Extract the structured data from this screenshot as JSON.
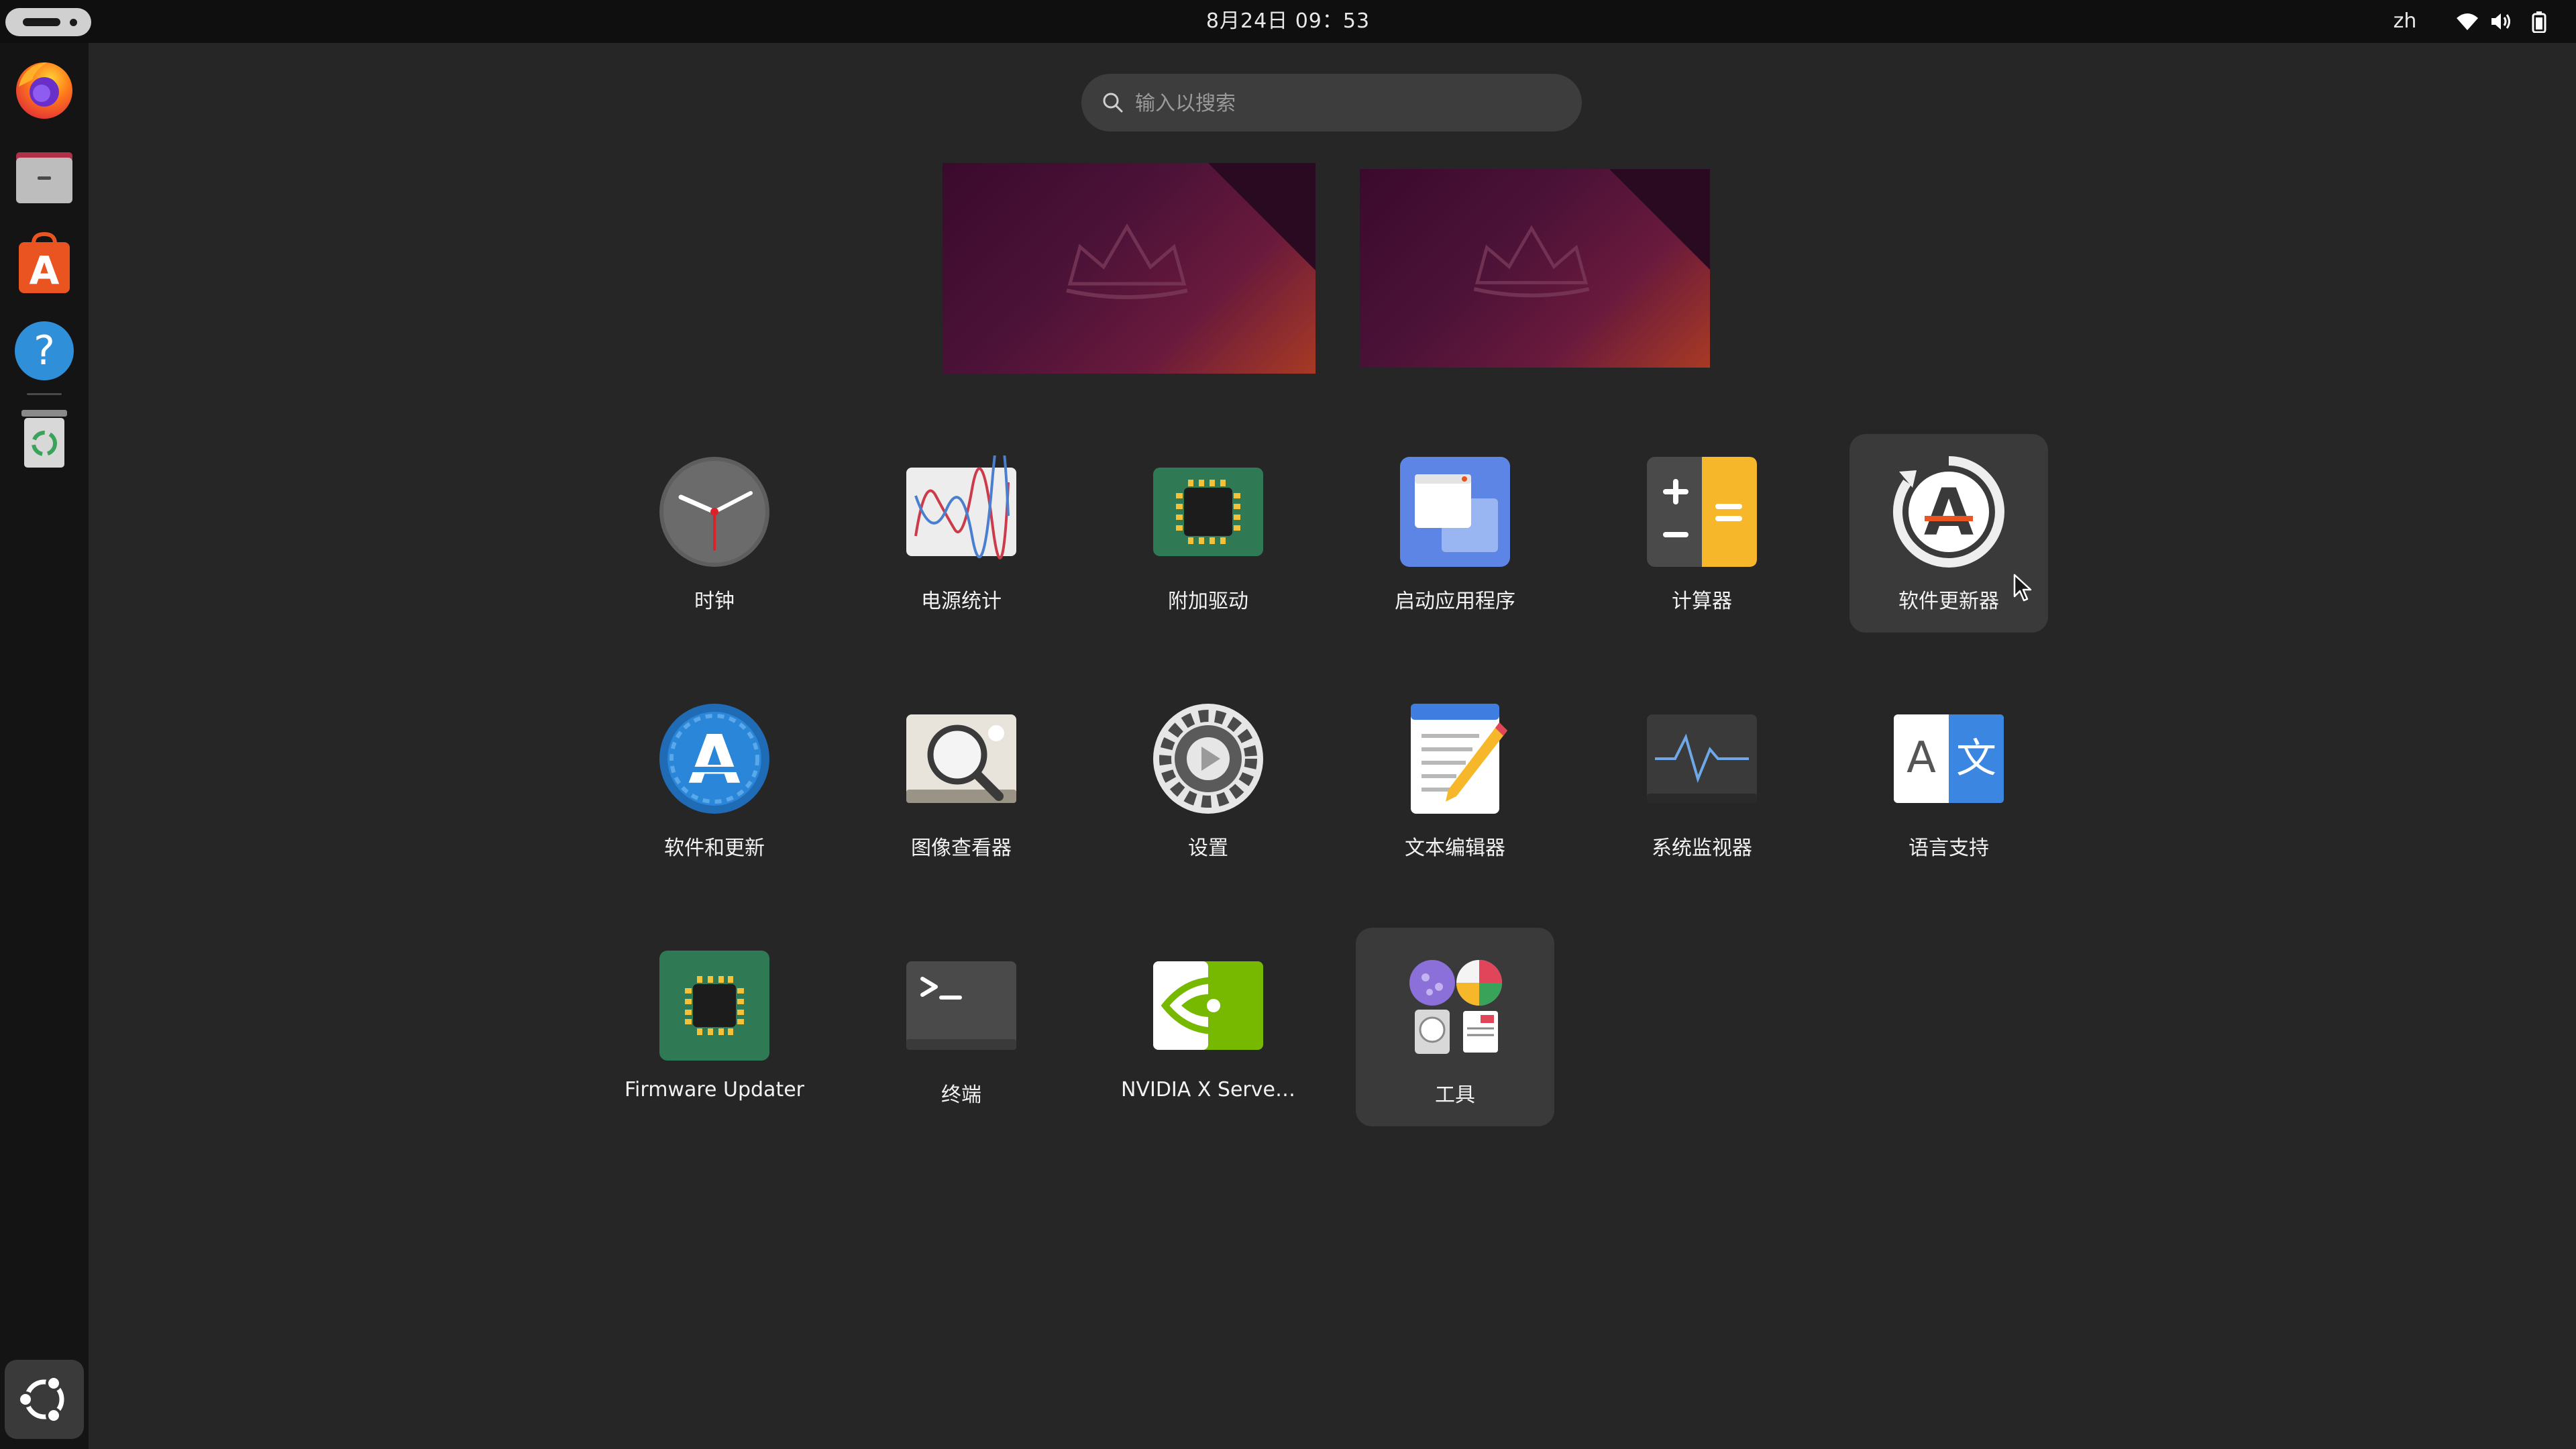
{
  "topbar": {
    "activities_label": "Activities",
    "clock": "8月24日  09：53",
    "keyboard_layout": "zh",
    "tray_icons": [
      "wifi-icon",
      "volume-icon",
      "battery-icon"
    ]
  },
  "dock": {
    "items": [
      {
        "name": "firefox",
        "icon": "firefox-icon"
      },
      {
        "name": "files",
        "icon": "files-icon"
      },
      {
        "name": "app-center",
        "icon": "app-center-icon"
      },
      {
        "name": "help",
        "icon": "help-icon"
      },
      {
        "name": "trash",
        "icon": "trash-icon"
      }
    ],
    "show_apps_icon": "ubuntu-logo-icon"
  },
  "search": {
    "placeholder": "输入以搜索",
    "value": ""
  },
  "workspaces": [
    {
      "name": "workspace-1",
      "active": true
    },
    {
      "name": "workspace-2",
      "active": false
    }
  ],
  "apps": [
    {
      "label": "时钟",
      "icon": "clock-icon"
    },
    {
      "label": "电源统计",
      "icon": "power-statistics-icon"
    },
    {
      "label": "附加驱动",
      "icon": "additional-drivers-icon"
    },
    {
      "label": "启动应用程序",
      "icon": "startup-applications-icon"
    },
    {
      "label": "计算器",
      "icon": "calculator-icon"
    },
    {
      "label": "软件更新器",
      "icon": "software-updater-icon",
      "state": "hover"
    },
    {
      "label": "软件和更新",
      "icon": "software-and-updates-icon"
    },
    {
      "label": "图像查看器",
      "icon": "image-viewer-icon"
    },
    {
      "label": "设置",
      "icon": "settings-icon"
    },
    {
      "label": "文本编辑器",
      "icon": "text-editor-icon"
    },
    {
      "label": "系统监视器",
      "icon": "system-monitor-icon"
    },
    {
      "label": "语言支持",
      "icon": "language-support-icon"
    },
    {
      "label": "Firmware Updater",
      "icon": "firmware-updater-icon"
    },
    {
      "label": "终端",
      "icon": "terminal-icon"
    },
    {
      "label": "NVIDIA X Serve…",
      "icon": "nvidia-settings-icon"
    },
    {
      "label": "工具",
      "icon": "utilities-folder-icon",
      "type": "folder"
    }
  ],
  "colors": {
    "background": "#262626",
    "topbar": "#0f0f0f",
    "dock": "#141414",
    "hover": "#3a3a3a",
    "accent_orange": "#e95420"
  }
}
